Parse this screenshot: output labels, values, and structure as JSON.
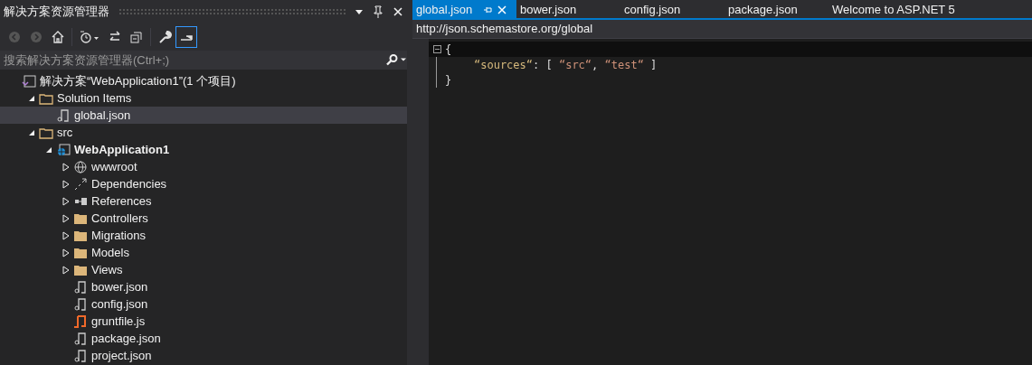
{
  "panel": {
    "title": "解决方案资源管理器",
    "toolbar": [
      {
        "kind": "back",
        "disabled": true
      },
      {
        "kind": "forward",
        "disabled": true
      },
      {
        "kind": "home",
        "disabled": false
      },
      {
        "kind": "history",
        "disabled": false
      },
      {
        "kind": "sync",
        "disabled": false
      },
      {
        "kind": "collapse",
        "disabled": false
      },
      {
        "kind": "properties",
        "disabled": false
      },
      {
        "kind": "preview",
        "disabled": false,
        "active": true
      }
    ],
    "search": {
      "placeholder": "搜索解决方案资源管理器(Ctrl+;)"
    },
    "tree": [
      {
        "kind": "solution",
        "label": "解决方案“WebApplication1”(1 个项目)",
        "selected": false,
        "children": [
          {
            "kind": "folder",
            "label": "Solution Items",
            "expanded": true,
            "selected": false,
            "children": [
              {
                "kind": "file",
                "label": "global.json",
                "selected": true
              }
            ]
          },
          {
            "kind": "folder",
            "label": "src",
            "expanded": true,
            "selected": false,
            "children": [
              {
                "kind": "project",
                "label": "WebApplication1",
                "expanded": true,
                "selected": false,
                "children": [
                  {
                    "kind": "web",
                    "label": "wwwroot",
                    "expanded": false,
                    "selected": false
                  },
                  {
                    "kind": "deps",
                    "label": "Dependencies",
                    "expanded": false,
                    "selected": false
                  },
                  {
                    "kind": "refs",
                    "label": "References",
                    "expanded": false,
                    "selected": false
                  },
                  {
                    "kind": "dir",
                    "label": "Controllers",
                    "expanded": false,
                    "selected": false
                  },
                  {
                    "kind": "dir",
                    "label": "Migrations",
                    "expanded": false,
                    "selected": false
                  },
                  {
                    "kind": "dir",
                    "label": "Models",
                    "expanded": false,
                    "selected": false
                  },
                  {
                    "kind": "dir",
                    "label": "Views",
                    "expanded": false,
                    "selected": false
                  },
                  {
                    "kind": "file",
                    "label": "bower.json",
                    "selected": false
                  },
                  {
                    "kind": "file",
                    "label": "config.json",
                    "selected": false
                  },
                  {
                    "kind": "script",
                    "label": "gruntfile.js",
                    "selected": false
                  },
                  {
                    "kind": "file",
                    "label": "package.json",
                    "selected": false
                  },
                  {
                    "kind": "file",
                    "label": "project.json",
                    "selected": false
                  }
                ]
              }
            ]
          }
        ]
      }
    ]
  },
  "editor": {
    "tabs": [
      {
        "label": "global.json",
        "selected": true
      },
      {
        "label": "bower.json",
        "selected": false
      },
      {
        "label": "config.json",
        "selected": false
      },
      {
        "label": "package.json",
        "selected": false
      },
      {
        "label": "Welcome to ASP.NET 5",
        "selected": false
      }
    ],
    "schema_url": "http://json.schemastore.org/global",
    "lines": [
      {
        "fold": true,
        "tokens": [
          {
            "kind": "punct",
            "text": "{"
          }
        ]
      },
      {
        "fold": false,
        "tokens": [
          {
            "kind": "key",
            "text": "“sources“"
          },
          {
            "kind": "punct",
            "text": ": [ "
          },
          {
            "kind": "string",
            "text": "“src“"
          },
          {
            "kind": "punct",
            "text": ", "
          },
          {
            "kind": "string",
            "text": "“test“"
          },
          {
            "kind": "punct",
            "text": " ]"
          }
        ]
      },
      {
        "fold": false,
        "tokens": [
          {
            "kind": "punct",
            "text": "}"
          }
        ]
      }
    ]
  }
}
